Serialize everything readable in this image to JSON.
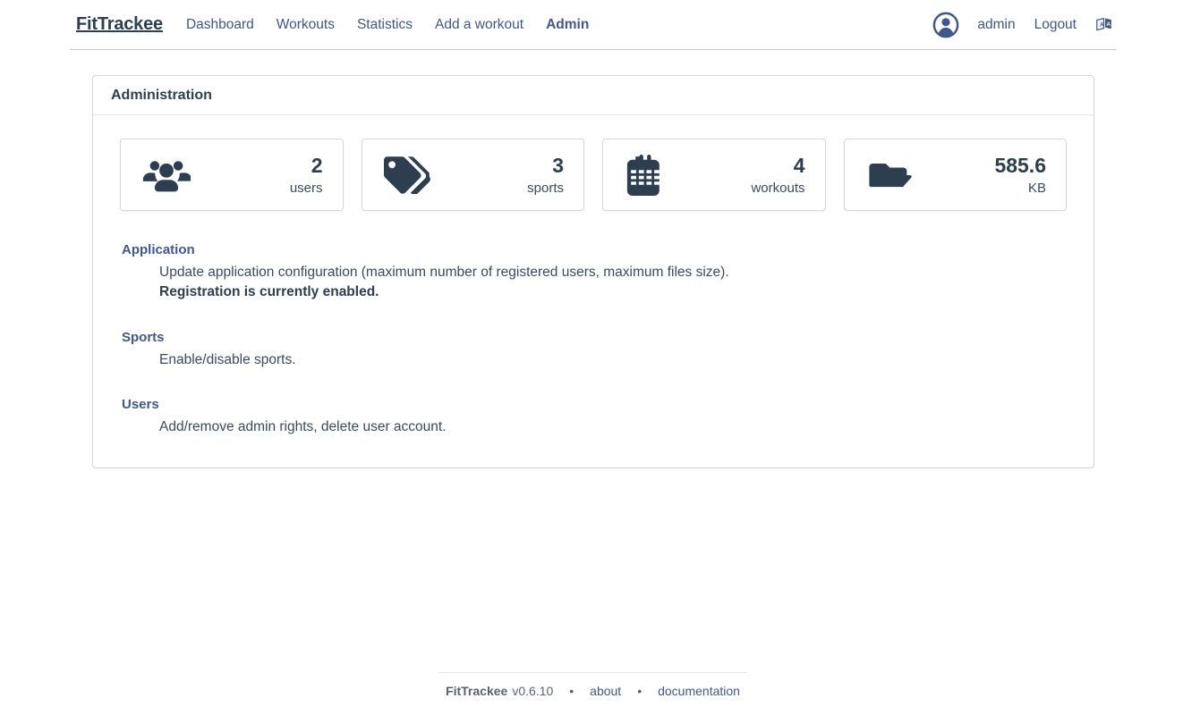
{
  "header": {
    "brand": "FitTrackee",
    "nav_items": [
      {
        "label": "Dashboard",
        "active": false
      },
      {
        "label": "Workouts",
        "active": false
      },
      {
        "label": "Statistics",
        "active": false
      },
      {
        "label": "Add a workout",
        "active": false
      },
      {
        "label": "Admin",
        "active": true
      }
    ],
    "avatar_icon": "user-circle-icon",
    "username": "admin",
    "logout_label": "Logout",
    "language_icon": "language-icon"
  },
  "panel": {
    "title": "Administration",
    "cards": [
      {
        "icon": "users-icon",
        "value": "2",
        "label": "users"
      },
      {
        "icon": "tags-icon",
        "value": "3",
        "label": "sports"
      },
      {
        "icon": "calendar-icon",
        "value": "4",
        "label": "workouts"
      },
      {
        "icon": "folder-open-icon",
        "value": "585.6",
        "label": "KB"
      }
    ],
    "sections": [
      {
        "title": "Application",
        "desc": "Update application configuration (maximum number of registered users, maximum files size).",
        "desc2": "Registration is currently enabled."
      },
      {
        "title": "Sports",
        "desc": "Enable/disable sports.",
        "desc2": ""
      },
      {
        "title": "Users",
        "desc": "Add/remove admin rights, delete user account.",
        "desc2": ""
      }
    ]
  },
  "footer": {
    "app": "FitTrackee",
    "version": "v0.6.10",
    "separator": "•",
    "about_label": "about",
    "documentation_label": "documentation"
  },
  "colors": {
    "accent": "#40578a",
    "text": "#2c3e50",
    "border": "#d3d7e0"
  }
}
